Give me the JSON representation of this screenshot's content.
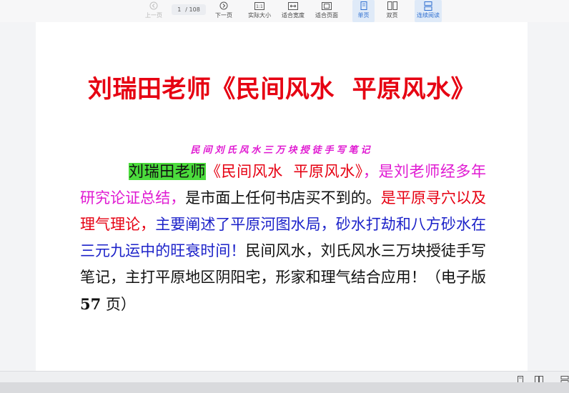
{
  "toolbar": {
    "prev_label": "上一页",
    "next_label": "下一页",
    "page_current": "1",
    "page_total": "/ 108",
    "actual_size_label": "实际大小",
    "fit_width_label": "适合宽度",
    "fit_page_label": "适合页面",
    "single_page_label": "单页",
    "double_page_label": "双页",
    "continuous_label": "连续阅读"
  },
  "document": {
    "title": "刘瑞田老师《民间风水  平原风水》",
    "subtitle": "民间刘氏风水三万块授徒手写笔记",
    "para": {
      "s1": "刘瑞田老师",
      "s2": "《民间风水  平原风水》",
      "s3": "，是刘老师经多年研究论证总结，",
      "s4": "是市面上任何书店买不到的。",
      "s5": "是平原寻穴以及理气理论，",
      "s6": "主要阐述了平原河图水局，砂水打劫和八方砂水在三元九运中的旺衰时间！",
      "s7": "民间风水，刘氏风水三万块授徒手写笔记，主打平原地区阴阳宅，形家和理气结合应用！（电子版 ",
      "s8": "57",
      "s9": " 页）"
    }
  },
  "colors": {
    "title_red": "#e60012",
    "magenta": "#e01ad2",
    "blue": "#1c22c9",
    "highlight_green": "#4bdc3c",
    "toolbar_active": "#2f6fd0"
  }
}
